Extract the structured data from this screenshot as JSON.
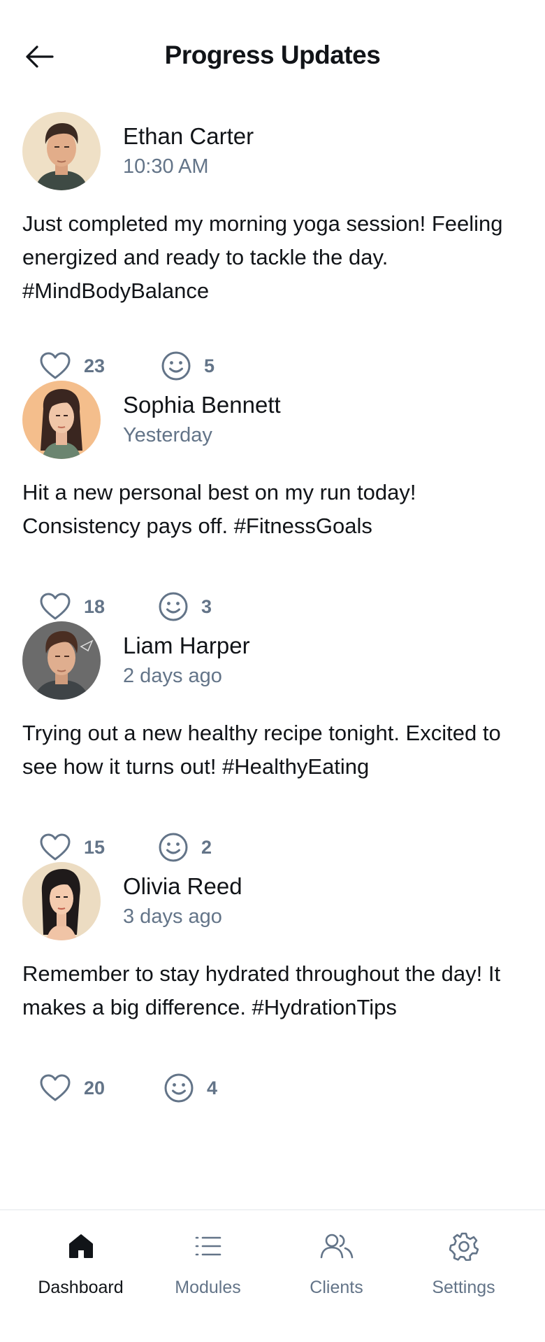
{
  "header": {
    "title": "Progress Updates"
  },
  "posts": [
    {
      "name": "Ethan Carter",
      "time": "10:30 AM",
      "text": "Just completed my morning yoga session! Feeling energized and ready to tackle the day. #MindBodyBalance",
      "likes": "23",
      "reactions": "5"
    },
    {
      "name": "Sophia Bennett",
      "time": "Yesterday",
      "text": "Hit a new personal best on my run today! Consistency pays off. #FitnessGoals",
      "likes": "18",
      "reactions": "3"
    },
    {
      "name": "Liam Harper",
      "time": "2 days ago",
      "text": "Trying out a new healthy recipe tonight. Excited to see how it turns out! #HealthyEating",
      "likes": "15",
      "reactions": "2"
    },
    {
      "name": "Olivia Reed",
      "time": "3 days ago",
      "text": "Remember to stay hydrated throughout the day! It makes a big difference. #HydrationTips",
      "likes": "20",
      "reactions": "4"
    }
  ],
  "nav": {
    "items": [
      {
        "label": "Dashboard",
        "icon": "home-icon",
        "active": true
      },
      {
        "label": "Modules",
        "icon": "list-icon",
        "active": false
      },
      {
        "label": "Clients",
        "icon": "users-icon",
        "active": false
      },
      {
        "label": "Settings",
        "icon": "gear-icon",
        "active": false
      }
    ]
  },
  "colors": {
    "text": "#111418",
    "muted": "#637488",
    "border": "#f0f2f4",
    "background": "#ffffff"
  }
}
